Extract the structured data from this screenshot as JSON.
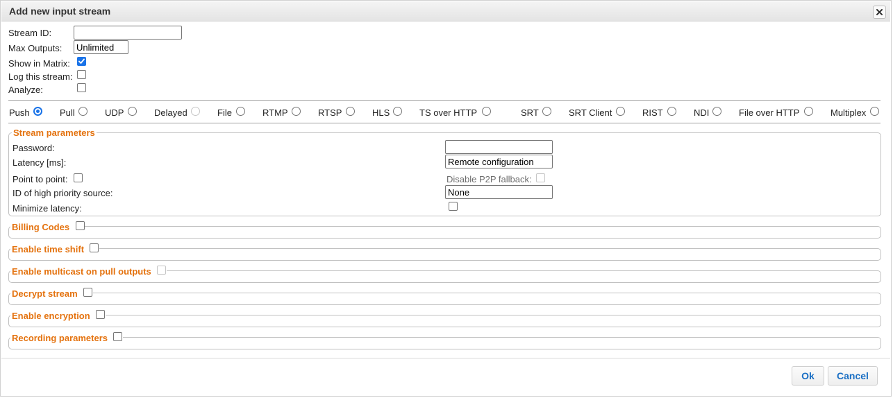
{
  "dialog": {
    "title": "Add new input stream",
    "close_glyph": "✖"
  },
  "general": {
    "stream_id_label": "Stream ID:",
    "stream_id_value": "",
    "max_outputs_label": "Max Outputs:",
    "max_outputs_value": "Unlimited",
    "show_in_matrix_label": "Show in Matrix:",
    "show_in_matrix_checked": true,
    "log_stream_label": "Log this stream:",
    "log_stream_checked": false,
    "analyze_label": "Analyze:",
    "analyze_checked": false
  },
  "protocols": [
    {
      "label": "Push",
      "selected": true,
      "disabled": false
    },
    {
      "label": "Pull",
      "selected": false,
      "disabled": false
    },
    {
      "label": "UDP",
      "selected": false,
      "disabled": false
    },
    {
      "label": "Delayed",
      "selected": false,
      "disabled": true
    },
    {
      "label": "File",
      "selected": false,
      "disabled": false
    },
    {
      "label": "RTMP",
      "selected": false,
      "disabled": false
    },
    {
      "label": "RTSP",
      "selected": false,
      "disabled": false
    },
    {
      "label": "HLS",
      "selected": false,
      "disabled": false
    },
    {
      "label": "TS over HTTP",
      "selected": false,
      "disabled": false
    },
    {
      "label": "SRT",
      "selected": false,
      "disabled": false
    },
    {
      "label": "SRT Client",
      "selected": false,
      "disabled": false
    },
    {
      "label": "RIST",
      "selected": false,
      "disabled": false
    },
    {
      "label": "NDI",
      "selected": false,
      "disabled": false
    },
    {
      "label": "File over HTTP",
      "selected": false,
      "disabled": false
    },
    {
      "label": "Multiplex",
      "selected": false,
      "disabled": false
    }
  ],
  "stream_parameters": {
    "legend": "Stream parameters",
    "password_label": "Password:",
    "password_value": "",
    "latency_label": "Latency [ms]:",
    "latency_value": "Remote configuration",
    "p2p_label": "Point to point:",
    "p2p_checked": false,
    "disable_p2p_fallback_label": "Disable P2P fallback:",
    "disable_p2p_fallback_checked": false,
    "high_priority_label": "ID of high priority source:",
    "high_priority_value": "None",
    "minimize_latency_label": "Minimize latency:",
    "minimize_latency_checked": false
  },
  "sections": [
    {
      "label": "Billing Codes",
      "checked": false,
      "disabled": false
    },
    {
      "label": "Enable time shift",
      "checked": false,
      "disabled": false
    },
    {
      "label": "Enable multicast on pull outputs",
      "checked": false,
      "disabled": true
    },
    {
      "label": "Decrypt stream",
      "checked": false,
      "disabled": false
    },
    {
      "label": "Enable encryption",
      "checked": false,
      "disabled": false
    },
    {
      "label": "Recording parameters",
      "checked": false,
      "disabled": false
    }
  ],
  "buttons": {
    "ok": "Ok",
    "cancel": "Cancel"
  },
  "colors": {
    "accent_orange": "#e4720e",
    "button_text_blue": "#1a6fc4",
    "checkbox_blue": "#1a73e8"
  }
}
